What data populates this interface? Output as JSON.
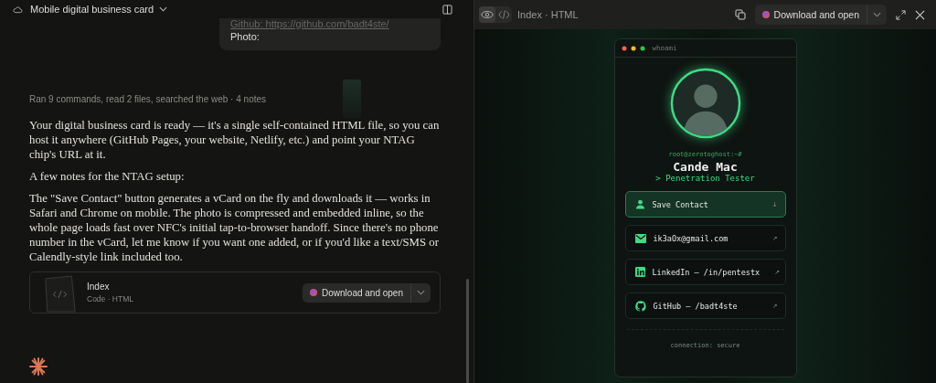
{
  "chat": {
    "title": "Mobile digital business card",
    "message_lines": [
      "Github: https://github.com/badt4ste/",
      "Photo:"
    ],
    "activity": "Ran 9 commands, read 2 files, searched the web · 4 notes",
    "paragraphs": [
      "Your digital business card is ready — it's a single self-contained HTML file, so you can host it anywhere (GitHub Pages, your website, Netlify, etc.) and point your NTAG chip's URL at it.",
      "A few notes for the NTAG setup:",
      "The \"Save Contact\" button generates a vCard on the fly and downloads it — works in Safari and Chrome on mobile. The photo is compressed and embedded inline, so the whole page loads fast over NFC's initial tap-to-browser handoff. Since there's no phone number in the vCard, let me know if you want one added, or if you'd like a text/SMS or Calendly-style link included too."
    ],
    "artifact": {
      "name": "Index",
      "meta": "Code · HTML",
      "button": "Download and open"
    }
  },
  "preview": {
    "views": [
      {
        "kind": "preview",
        "selected": true
      },
      {
        "kind": "code",
        "selected": false
      }
    ],
    "title": "Index · HTML",
    "button": "Download and open",
    "card": {
      "window_title": "whoami",
      "prompt": "root@zerotoghost:~#",
      "name": "Cande Mac",
      "role": "> Penetration Tester",
      "links": [
        {
          "kind": "save",
          "label": "Save Contact",
          "arrow": "↓"
        },
        {
          "kind": "email",
          "label": "ik3aOx@gmail.com",
          "arrow": "↗"
        },
        {
          "kind": "linkedin",
          "label": "LinkedIn — /in/pentestx",
          "arrow": "↗"
        },
        {
          "kind": "github",
          "label": "GitHub — /badt4ste",
          "arrow": "↗"
        }
      ],
      "footer": "connection: secure"
    }
  }
}
